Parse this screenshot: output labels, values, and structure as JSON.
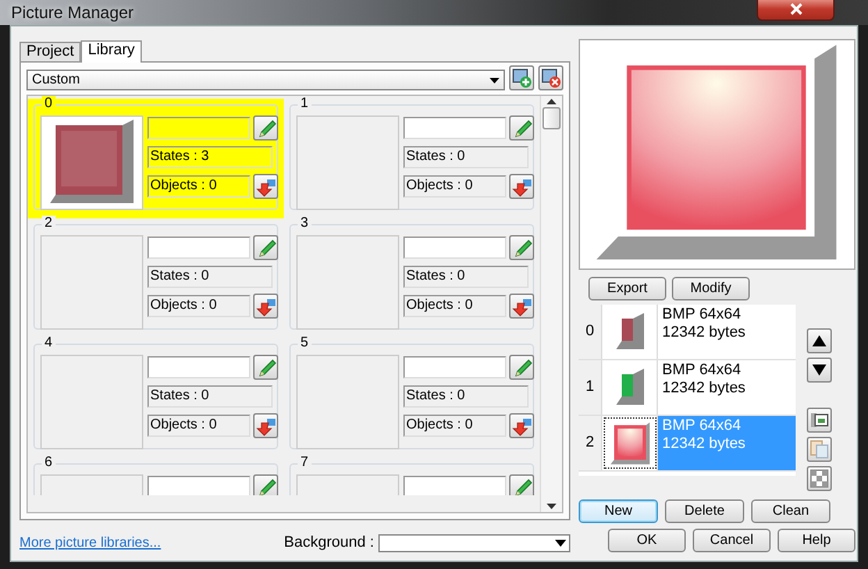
{
  "window": {
    "title": "Picture Manager"
  },
  "tabs": [
    {
      "label": "Project",
      "selected": false
    },
    {
      "label": "Library",
      "selected": true
    }
  ],
  "library": {
    "value": "Custom"
  },
  "slots": [
    {
      "index": "0",
      "selected": true,
      "color": "#a84a55",
      "states": "States : 3",
      "objects": "Objects : 0"
    },
    {
      "index": "1",
      "selected": false,
      "states": "States : 0",
      "objects": "Objects : 0"
    },
    {
      "index": "2",
      "selected": false,
      "states": "States : 0",
      "objects": "Objects : 0"
    },
    {
      "index": "3",
      "selected": false,
      "states": "States : 0",
      "objects": "Objects : 0"
    },
    {
      "index": "4",
      "selected": false,
      "states": "States : 0",
      "objects": "Objects : 0"
    },
    {
      "index": "5",
      "selected": false,
      "states": "States : 0",
      "objects": "Objects : 0"
    },
    {
      "index": "6",
      "selected": false
    },
    {
      "index": "7",
      "selected": false
    }
  ],
  "link": "More picture libraries...",
  "background": {
    "label": "Background :"
  },
  "image_buttons": [
    "Export",
    "Modify"
  ],
  "images": [
    {
      "index": "0",
      "kind": "bevel",
      "color": "#a84a55",
      "format": "BMP 64x64",
      "size": "12342 bytes",
      "selected": false
    },
    {
      "index": "1",
      "kind": "bevel",
      "color": "#22b04a",
      "format": "BMP 64x64",
      "size": "12342 bytes",
      "selected": false
    },
    {
      "index": "2",
      "kind": "glow",
      "color": "#e85060",
      "format": "BMP 64x64",
      "size": "12342 bytes",
      "selected": true
    }
  ],
  "image_actions": [
    {
      "label": "New",
      "default": true
    },
    {
      "label": "Delete",
      "default": false
    },
    {
      "label": "Clean",
      "default": false
    }
  ],
  "dialog_buttons": [
    "OK",
    "Cancel",
    "Help"
  ]
}
